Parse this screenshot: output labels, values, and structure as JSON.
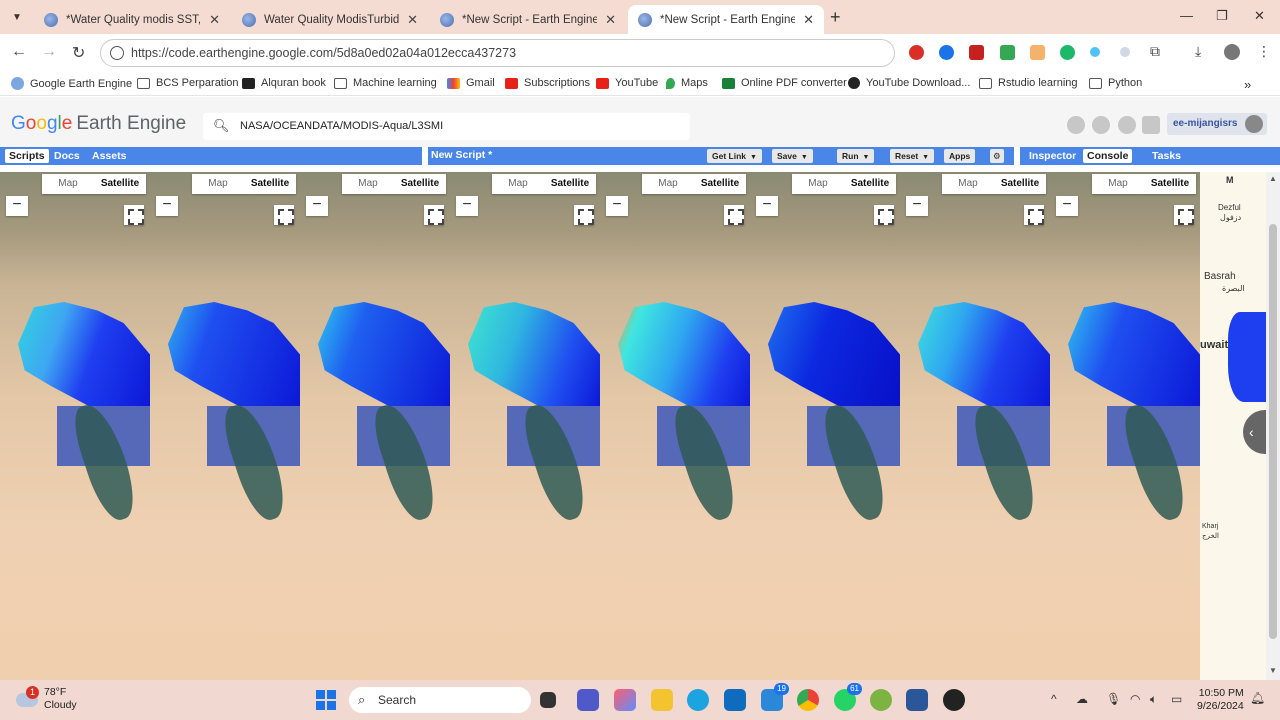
{
  "browser": {
    "tabs": [
      {
        "title": "*Water Quality modis SST, Chlo"
      },
      {
        "title": "Water Quality ModisTurbidity -"
      },
      {
        "title": "*New Script - Earth Engine Cod"
      },
      {
        "title": "*New Script - Earth Engine Cod"
      }
    ],
    "url": "https://code.earthengine.google.com/5d8a0ed02a04a012ecca437273",
    "bookmarks": [
      {
        "label": "Google Earth Engine"
      },
      {
        "label": "BCS Perparation"
      },
      {
        "label": "Alquran book"
      },
      {
        "label": "Machine learning"
      },
      {
        "label": "Gmail"
      },
      {
        "label": "Subscriptions"
      },
      {
        "label": "YouTube"
      },
      {
        "label": "Maps"
      },
      {
        "label": "Online PDF converter"
      },
      {
        "label": "YouTube Download..."
      },
      {
        "label": "Rstudio learning"
      },
      {
        "label": "Python"
      }
    ],
    "more_bookmarks": "»"
  },
  "gee": {
    "logo_google": [
      "G",
      "o",
      "o",
      "g",
      "l",
      "e"
    ],
    "logo_product": "Earth Engine",
    "search_value": "NASA/OCEANDATA/MODIS-Aqua/L3SMI",
    "user": "ee-mijangisrs",
    "left_tabs": [
      "Scripts",
      "Docs",
      "Assets"
    ],
    "script_title": "New Script *",
    "buttons": [
      "Get Link",
      "Save",
      "Run",
      "Reset",
      "Apps"
    ],
    "right_tabs": [
      "Inspector",
      "Console",
      "Tasks"
    ],
    "map_type": {
      "map": "Map",
      "satellite": "Satellite"
    },
    "zoom_out": "−",
    "road_labels": [
      "Dezful",
      "دزفول",
      "Basrah",
      "البصرة",
      "uwait",
      "Kharj",
      "الخرج"
    ],
    "road_map_type": "M"
  },
  "taskbar": {
    "temp": "78°F",
    "condition": "Cloudy",
    "weather_badge": "1",
    "search": "Search",
    "teams_count": "19",
    "whatsapp_count": "61",
    "time": "10:50 PM",
    "date": "9/26/2024"
  }
}
